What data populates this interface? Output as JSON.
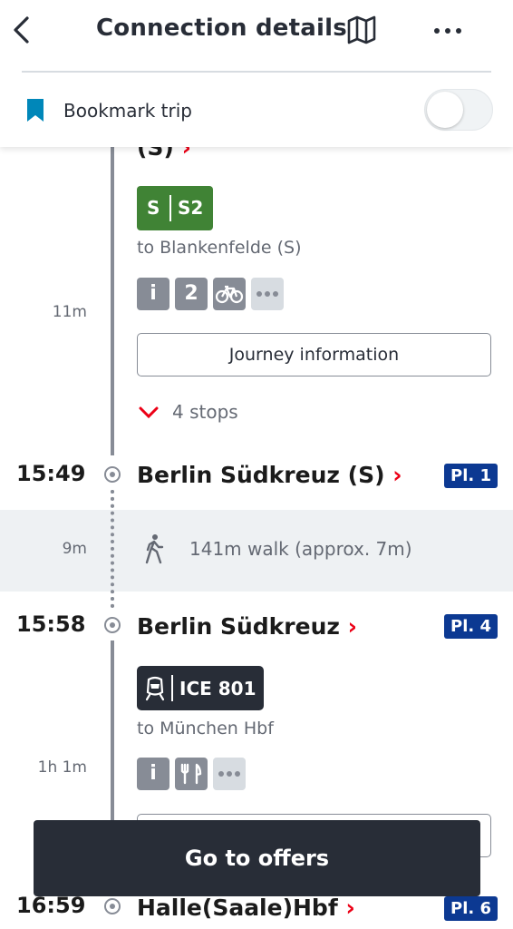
{
  "header": {
    "title": "Connection details",
    "bookmark_label": "Bookmark trip",
    "bookmark_toggle_on": false
  },
  "leg1": {
    "station_cut": "(S)",
    "line_type": "S",
    "line_name": "S2",
    "destination": "to Blankenfelde (S)",
    "duration": "11m",
    "icon_info": "i",
    "icon_class": "2",
    "journey_button": "Journey information",
    "stops": "4 stops"
  },
  "stop1": {
    "time": "15:49",
    "name": "Berlin Südkreuz (S)",
    "platform": "Pl. 1"
  },
  "walk": {
    "duration": "9m",
    "text": "141m walk (approx. 7m)"
  },
  "stop2": {
    "time": "15:58",
    "name": "Berlin Südkreuz",
    "platform": "Pl. 4"
  },
  "leg2": {
    "line_name": "ICE 801",
    "destination": "to München Hbf",
    "duration": "1h 1m",
    "icon_info": "i"
  },
  "stop3": {
    "time": "16:59",
    "name": "Halle(Saale)Hbf",
    "platform": "Pl. 6"
  },
  "footer": {
    "offers_button": "Go to offers"
  },
  "colors": {
    "accent_red": "#ec0016",
    "s_bahn_green": "#408335",
    "platform_blue": "#0c3992",
    "dark": "#282d37"
  }
}
